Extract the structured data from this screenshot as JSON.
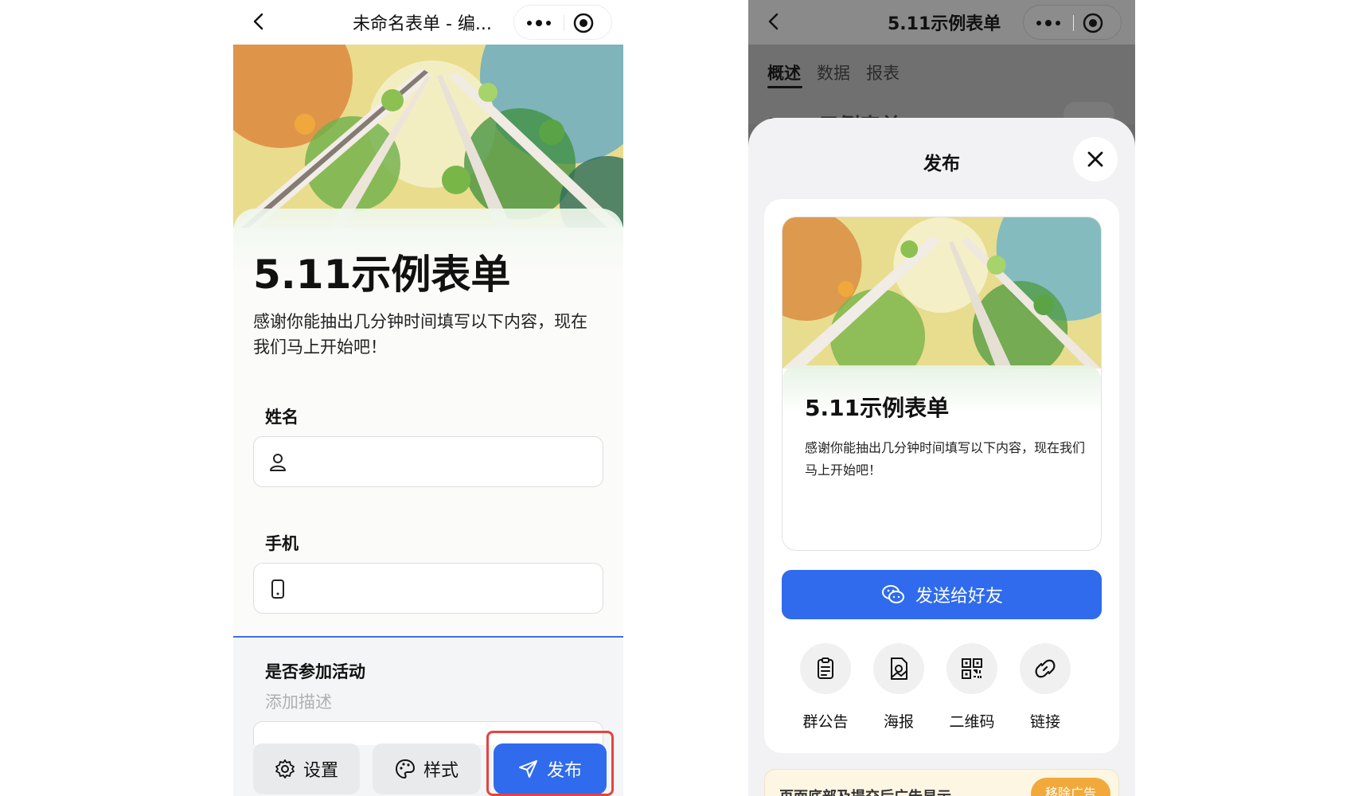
{
  "left": {
    "nav": {
      "title": "未命名表单 - 编..."
    },
    "form": {
      "title": "5.11示例表单",
      "description": "感谢你能抽出几分钟时间填写以下内容，现在我们马上开始吧！"
    },
    "fields": [
      {
        "label": "姓名",
        "icon": "user-icon"
      },
      {
        "label": "手机",
        "icon": "phone-icon"
      }
    ],
    "activity": {
      "title": "是否参加活动",
      "description_placeholder": "添加描述"
    },
    "bottom": {
      "settings": "设置",
      "style": "样式",
      "publish": "发布"
    },
    "colors": {
      "accent": "#2f6bec",
      "highlight": "#e5443e"
    }
  },
  "right": {
    "nav": {
      "title": "5.11示例表单"
    },
    "tabs": [
      {
        "label": "概述",
        "active": true
      },
      {
        "label": "数据",
        "active": false
      },
      {
        "label": "报表",
        "active": false
      }
    ],
    "sheet": {
      "title": "发布",
      "preview_title": "5.11示例表单",
      "preview_description": "感谢你能抽出几分钟时间填写以下内容，现在我们马上开始吧！",
      "send_button": "发送给好友",
      "share_options": [
        {
          "label": "群公告",
          "icon": "clipboard-icon"
        },
        {
          "label": "海报",
          "icon": "poster-icon"
        },
        {
          "label": "二维码",
          "icon": "qrcode-icon"
        },
        {
          "label": "链接",
          "icon": "link-icon"
        }
      ],
      "ad_text": "页面底部及提交后广告显示",
      "ad_button": "移除广告"
    }
  }
}
